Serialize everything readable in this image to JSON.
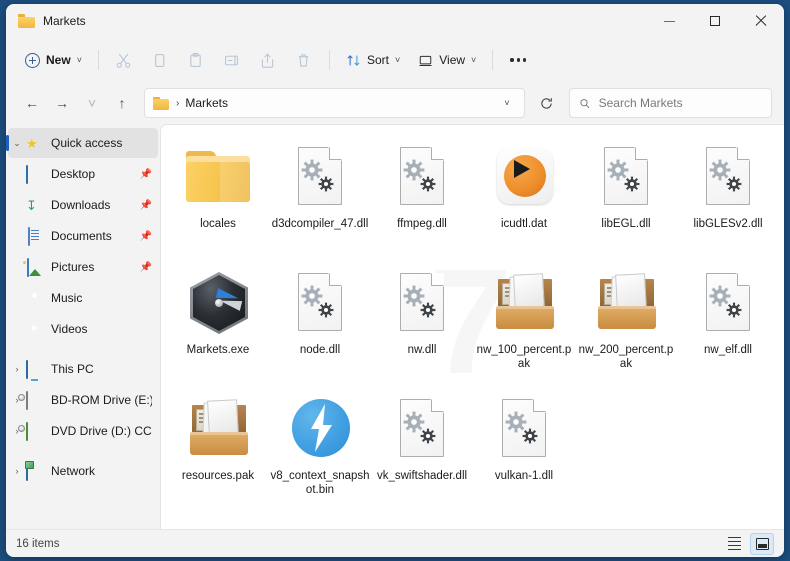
{
  "window": {
    "title": "Markets",
    "title_icon": "folder-icon",
    "minimize_label": "Minimize",
    "maximize_label": "Maximize",
    "close_label": "Close"
  },
  "toolbar": {
    "new_label": "New",
    "new_chevron": "˅",
    "sort_label": "Sort",
    "view_label": "View",
    "sort_chevron": "˅",
    "view_chevron": "˅",
    "icons": [
      {
        "name": "cut-icon",
        "label": "Cut",
        "enabled": false
      },
      {
        "name": "copy-icon",
        "label": "Copy",
        "enabled": false
      },
      {
        "name": "paste-icon",
        "label": "Paste",
        "enabled": false
      },
      {
        "name": "rename-icon",
        "label": "Rename",
        "enabled": false
      },
      {
        "name": "share-icon",
        "label": "Share",
        "enabled": false
      },
      {
        "name": "delete-icon",
        "label": "Delete",
        "enabled": false
      }
    ],
    "more_label": "See more"
  },
  "address": {
    "back_glyph": "←",
    "forward_glyph": "→",
    "recent_glyph": "˅",
    "up_glyph": "↑",
    "folder_icon": "folder-icon",
    "separator": "›",
    "crumb": "Markets",
    "dropdown_glyph": "˅",
    "refresh_label": "Refresh"
  },
  "search": {
    "placeholder": "Search Markets",
    "value": "",
    "icon": "search-icon"
  },
  "sidebar": {
    "items": [
      {
        "label": "Quick access",
        "icon": "star-icon",
        "expander": "⌄",
        "expanded": true,
        "selected": true,
        "pinned": false,
        "child": false
      },
      {
        "label": "Desktop",
        "icon": "desktop-icon",
        "expander": "",
        "expanded": false,
        "selected": false,
        "pinned": true,
        "child": true
      },
      {
        "label": "Downloads",
        "icon": "downloads-icon",
        "expander": "",
        "expanded": false,
        "selected": false,
        "pinned": true,
        "child": true
      },
      {
        "label": "Documents",
        "icon": "documents-icon",
        "expander": "",
        "expanded": false,
        "selected": false,
        "pinned": true,
        "child": true
      },
      {
        "label": "Pictures",
        "icon": "pictures-icon",
        "expander": "",
        "expanded": false,
        "selected": false,
        "pinned": true,
        "child": true
      },
      {
        "label": "Music",
        "icon": "music-icon",
        "expander": "",
        "expanded": false,
        "selected": false,
        "pinned": false,
        "child": true
      },
      {
        "label": "Videos",
        "icon": "videos-icon",
        "expander": "",
        "expanded": false,
        "selected": false,
        "pinned": false,
        "child": true
      },
      {
        "label": "This PC",
        "icon": "this-pc-icon",
        "expander": "›",
        "expanded": false,
        "selected": false,
        "pinned": false,
        "child": false
      },
      {
        "label": "BD-ROM Drive (E:) C",
        "icon": "bd-rom-drive-icon",
        "expander": "›",
        "expanded": false,
        "selected": false,
        "pinned": false,
        "child": false
      },
      {
        "label": "DVD Drive (D:) CCCC",
        "icon": "dvd-drive-icon",
        "expander": "›",
        "expanded": false,
        "selected": false,
        "pinned": false,
        "child": false
      },
      {
        "label": "Network",
        "icon": "network-icon",
        "expander": "›",
        "expanded": false,
        "selected": false,
        "pinned": false,
        "child": false
      }
    ]
  },
  "files": [
    {
      "name": "locales",
      "icon": "folder-icon"
    },
    {
      "name": "d3dcompiler_47.dll",
      "icon": "dll-gears-icon"
    },
    {
      "name": "ffmpeg.dll",
      "icon": "dll-gears-icon"
    },
    {
      "name": "icudtl.dat",
      "icon": "media-player-icon"
    },
    {
      "name": "libEGL.dll",
      "icon": "dll-gears-icon"
    },
    {
      "name": "libGLESv2.dll",
      "icon": "dll-gears-icon"
    },
    {
      "name": "Markets.exe",
      "icon": "markets-app-icon"
    },
    {
      "name": "node.dll",
      "icon": "dll-gears-icon"
    },
    {
      "name": "nw.dll",
      "icon": "dll-gears-icon"
    },
    {
      "name": "nw_100_percent.pak",
      "icon": "pak-archive-icon"
    },
    {
      "name": "nw_200_percent.pak",
      "icon": "pak-archive-icon"
    },
    {
      "name": "nw_elf.dll",
      "icon": "dll-gears-icon"
    },
    {
      "name": "resources.pak",
      "icon": "pak-archive-icon"
    },
    {
      "name": "v8_context_snapshot.bin",
      "icon": "bolt-icon"
    },
    {
      "name": "vk_swiftshader.dll",
      "icon": "dll-gears-icon"
    },
    {
      "name": "vulkan-1.dll",
      "icon": "dll-gears-icon"
    }
  ],
  "watermark": {
    "text": "7"
  },
  "statusbar": {
    "item_count": "16 items",
    "list_view_label": "Details view",
    "icons_view_label": "Large icons view"
  },
  "colors": {
    "desktop": "#1c4e80",
    "chrome": "#f3f3f3",
    "content": "#ffffff",
    "accent": "#1c5fbe",
    "selection": "#dceaf7",
    "folder": "#f7c54f"
  }
}
